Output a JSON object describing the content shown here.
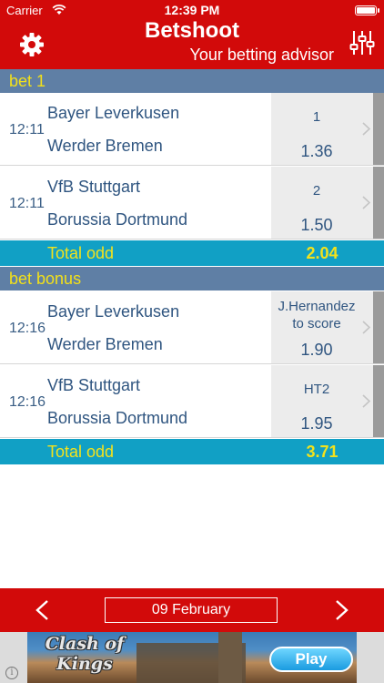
{
  "status_bar": {
    "carrier": "Carrier",
    "time": "12:39 PM"
  },
  "header": {
    "title": "Betshoot",
    "subtitle": "Your betting advisor"
  },
  "sections": [
    {
      "title": "bet 1",
      "rows": [
        {
          "time": "12:11",
          "home": "Bayer Leverkusen",
          "away": "Werder Bremen",
          "bet": "1",
          "odd": "1.36"
        },
        {
          "time": "12:11",
          "home": "VfB Stuttgart",
          "away": "Borussia Dortmund",
          "bet": "2",
          "odd": "1.50"
        }
      ],
      "total_label": "Total odd",
      "total_value": "2.04"
    },
    {
      "title": "bet bonus",
      "rows": [
        {
          "time": "12:16",
          "home": "Bayer Leverkusen",
          "away": "Werder Bremen",
          "bet_line1": "J.Hernandez",
          "bet_line2": "to score",
          "odd": "1.90"
        },
        {
          "time": "12:16",
          "home": "VfB Stuttgart",
          "away": "Borussia Dortmund",
          "bet": "HT2",
          "odd": "1.95"
        }
      ],
      "total_label": "Total odd",
      "total_value": "3.71"
    }
  ],
  "footer": {
    "date": "09 February"
  },
  "ad": {
    "game_title_line1": "Clash of",
    "game_title_line2": "Kings",
    "play_label": "Play",
    "info_glyph": "i"
  },
  "colors": {
    "header_red": "#d20a0a",
    "section_blue": "#5f7fa5",
    "total_teal": "#11a0c5",
    "accent_yellow": "#f3e21c",
    "text_blue": "#2f5580"
  }
}
